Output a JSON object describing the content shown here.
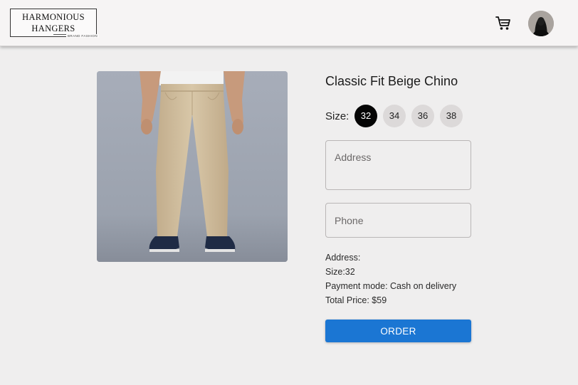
{
  "header": {
    "logo": {
      "line1": "HARMONIOUS",
      "line2": "HANGERS",
      "tagline": "BRAND FASHION"
    },
    "cart_icon": "shopping-cart-icon",
    "avatar_icon": "user-avatar"
  },
  "product": {
    "title": "Classic Fit Beige Chino",
    "image": "beige-chino-photo",
    "size_label": "Size:",
    "sizes": [
      "32",
      "34",
      "36",
      "38"
    ],
    "selected_size": "32"
  },
  "form": {
    "address_placeholder": "Address",
    "address_value": "",
    "phone_placeholder": "Phone",
    "phone_value": ""
  },
  "summary": {
    "address": "Address:",
    "size": "Size:32",
    "payment": "Payment mode: Cash on delivery",
    "total": "Total Price: $59"
  },
  "order_button": "ORDER",
  "colors": {
    "accent": "#1b76d3",
    "selected_chip": "#050505",
    "chip": "#dcd9d9",
    "background": "#efeeee"
  }
}
